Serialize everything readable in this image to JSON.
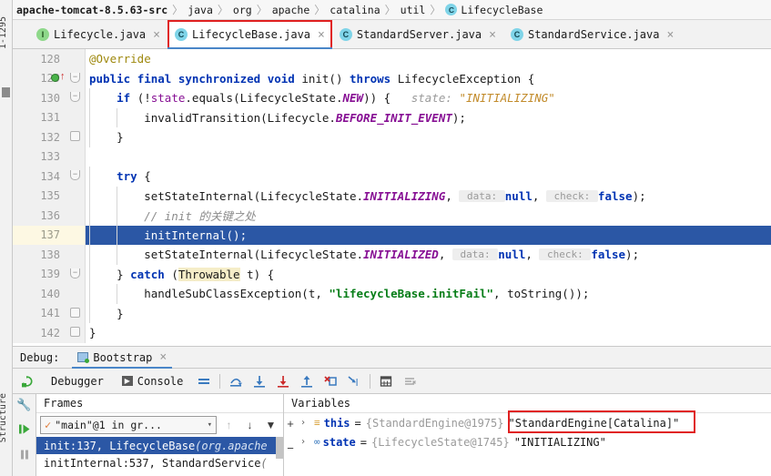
{
  "window": {
    "left_strip_text_top": "1-1295",
    "left_strip_text_bottom": "Structure"
  },
  "breadcrumb": {
    "root": "apache-tomcat-8.5.63-src",
    "separator": "〉",
    "items": [
      "java",
      "org",
      "apache",
      "catalina",
      "util"
    ],
    "leaf_icon": "C",
    "leaf": "LifecycleBase"
  },
  "tabs": [
    {
      "icon": "I",
      "icon_kind": "interface",
      "label": "Lifecycle.java",
      "active": false,
      "highlighted": false,
      "close": "×"
    },
    {
      "icon": "C",
      "icon_kind": "class",
      "label": "LifecycleBase.java",
      "active": true,
      "highlighted": true,
      "close": "×"
    },
    {
      "icon": "C",
      "icon_kind": "class",
      "label": "StandardServer.java",
      "active": false,
      "highlighted": false,
      "close": "×"
    },
    {
      "icon": "C",
      "icon_kind": "class",
      "label": "StandardService.java",
      "active": false,
      "highlighted": false,
      "close": "×"
    }
  ],
  "editor": {
    "highlighted_line": 137,
    "lines": [
      {
        "num": "128",
        "fold": "",
        "bp": false,
        "hl": false,
        "indent": 0,
        "tokens": [
          {
            "t": "@Override",
            "c": "anno"
          }
        ]
      },
      {
        "num": "129",
        "fold": "open",
        "bp": true,
        "hl": false,
        "indent": 0,
        "tokens": [
          {
            "t": "public ",
            "c": "kw"
          },
          {
            "t": "final ",
            "c": "kw"
          },
          {
            "t": "synchronized ",
            "c": "kw"
          },
          {
            "t": "void ",
            "c": "kw"
          },
          {
            "t": "init() ",
            "c": "plain"
          },
          {
            "t": "throws ",
            "c": "kw"
          },
          {
            "t": "LifecycleException {",
            "c": "plain"
          }
        ]
      },
      {
        "num": "130",
        "fold": "open",
        "bp": false,
        "hl": false,
        "indent": 1,
        "tokens": [
          {
            "t": "    ",
            "c": "plain"
          },
          {
            "t": "if ",
            "c": "kw"
          },
          {
            "t": "(!",
            "c": "plain"
          },
          {
            "t": "state",
            "c": "fld"
          },
          {
            "t": ".equals(LifecycleState.",
            "c": "plain"
          },
          {
            "t": "NEW",
            "c": "cst"
          },
          {
            "t": ")) {",
            "c": "plain"
          },
          {
            "t": "   ",
            "c": "plain"
          },
          {
            "t": "state: ",
            "c": "dbgkey"
          },
          {
            "t": "\"INITIALIZING\"",
            "c": "dbgval"
          }
        ]
      },
      {
        "num": "131",
        "fold": "",
        "bp": false,
        "hl": false,
        "indent": 2,
        "tokens": [
          {
            "t": "        invalidTransition(Lifecycle.",
            "c": "plain"
          },
          {
            "t": "BEFORE_INIT_EVENT",
            "c": "cst"
          },
          {
            "t": ");",
            "c": "plain"
          }
        ]
      },
      {
        "num": "132",
        "fold": "closed",
        "bp": false,
        "hl": false,
        "indent": 1,
        "tokens": [
          {
            "t": "    }",
            "c": "plain"
          }
        ]
      },
      {
        "num": "133",
        "fold": "",
        "bp": false,
        "hl": false,
        "indent": 0,
        "tokens": []
      },
      {
        "num": "134",
        "fold": "open",
        "bp": false,
        "hl": false,
        "indent": 1,
        "tokens": [
          {
            "t": "    ",
            "c": "plain"
          },
          {
            "t": "try ",
            "c": "kw"
          },
          {
            "t": "{",
            "c": "plain"
          }
        ]
      },
      {
        "num": "135",
        "fold": "",
        "bp": false,
        "hl": false,
        "indent": 2,
        "tokens": [
          {
            "t": "        setStateInternal(LifecycleState.",
            "c": "plain"
          },
          {
            "t": "INITIALIZING",
            "c": "cst"
          },
          {
            "t": ", ",
            "c": "plain"
          },
          {
            "t": " data: ",
            "c": "hint"
          },
          {
            "t": "null",
            "c": "hintv"
          },
          {
            "t": ", ",
            "c": "plain"
          },
          {
            "t": " check: ",
            "c": "hint"
          },
          {
            "t": "false",
            "c": "hintv"
          },
          {
            "t": ");",
            "c": "plain"
          }
        ]
      },
      {
        "num": "136",
        "fold": "",
        "bp": false,
        "hl": false,
        "indent": 2,
        "tokens": [
          {
            "t": "        // init 的关键之处",
            "c": "cmt"
          }
        ]
      },
      {
        "num": "137",
        "fold": "",
        "bp": false,
        "hl": true,
        "indent": 2,
        "tokens": [
          {
            "t": "        initInternal();",
            "c": "plain"
          }
        ]
      },
      {
        "num": "138",
        "fold": "",
        "bp": false,
        "hl": false,
        "indent": 2,
        "tokens": [
          {
            "t": "        setStateInternal(LifecycleState.",
            "c": "plain"
          },
          {
            "t": "INITIALIZED",
            "c": "cst"
          },
          {
            "t": ", ",
            "c": "plain"
          },
          {
            "t": " data: ",
            "c": "hint"
          },
          {
            "t": "null",
            "c": "hintv"
          },
          {
            "t": ", ",
            "c": "plain"
          },
          {
            "t": " check: ",
            "c": "hint"
          },
          {
            "t": "false",
            "c": "hintv"
          },
          {
            "t": ");",
            "c": "plain"
          }
        ]
      },
      {
        "num": "139",
        "fold": "open",
        "bp": false,
        "hl": false,
        "indent": 1,
        "tokens": [
          {
            "t": "    } ",
            "c": "plain"
          },
          {
            "t": "catch ",
            "c": "kw"
          },
          {
            "t": "(",
            "c": "plain"
          },
          {
            "t": "Throwable",
            "c": "hlyellow"
          },
          {
            "t": " t) {",
            "c": "plain"
          }
        ]
      },
      {
        "num": "140",
        "fold": "",
        "bp": false,
        "hl": false,
        "indent": 2,
        "tokens": [
          {
            "t": "        handleSubClassException(t, ",
            "c": "plain"
          },
          {
            "t": "\"lifecycleBase.initFail\"",
            "c": "str"
          },
          {
            "t": ", toString());",
            "c": "plain"
          }
        ]
      },
      {
        "num": "141",
        "fold": "closed",
        "bp": false,
        "hl": false,
        "indent": 1,
        "tokens": [
          {
            "t": "    }",
            "c": "plain"
          }
        ]
      },
      {
        "num": "142",
        "fold": "closed",
        "bp": false,
        "hl": false,
        "indent": 0,
        "tokens": [
          {
            "t": "}",
            "c": "plain"
          }
        ]
      }
    ]
  },
  "debug": {
    "label": "Debug:",
    "session_tab": "Bootstrap",
    "session_close": "×",
    "toolbar": {
      "rerun_icon": "↻",
      "debugger_tab": "Debugger",
      "console_tab": "Console",
      "console_icon": "▶",
      "icons": [
        "layout-icon",
        "step-over-icon",
        "step-into-icon",
        "force-step-into-icon",
        "step-out-icon",
        "drop-frame-icon",
        "run-to-cursor-icon",
        "evaluate-icon",
        "mute-breakpoints-icon"
      ]
    },
    "frames": {
      "title": "Frames",
      "thread": "\"main\"@1 in gr...",
      "thread_check": "✓",
      "caret": "▾",
      "up": "↑",
      "down": "↓",
      "filter": "▼",
      "rows": [
        {
          "text": "init:137, LifecycleBase ",
          "pkg": "(org.apache",
          "selected": true
        },
        {
          "text": "initInternal:537, StandardService ",
          "pkg": "(",
          "selected": false
        }
      ]
    },
    "variables": {
      "title": "Variables",
      "add": "+",
      "remove": "−",
      "rows": [
        {
          "twisty": "›",
          "icon": "≡",
          "icon_kind": "object",
          "name": "this",
          "eq": " = ",
          "ref": "{StandardEngine@1975}",
          "value": "\"StandardEngine[Catalina]\"",
          "boxed": true
        },
        {
          "twisty": "›",
          "icon": "∞",
          "icon_kind": "enum",
          "name": "state",
          "eq": " = ",
          "ref": "{LifecycleState@1745}",
          "value": "\"INITIALIZING\"",
          "boxed": false
        }
      ]
    }
  },
  "colors": {
    "accent_blue": "#2b57a5",
    "tab_underline": "#4a86c8",
    "highlight_red": "#e02020",
    "keyword": "#0033b3",
    "string": "#067d17",
    "constant": "#871094",
    "comment": "#8c8c8c",
    "annotation": "#9e880d",
    "debug_value": "#c28b2b"
  }
}
